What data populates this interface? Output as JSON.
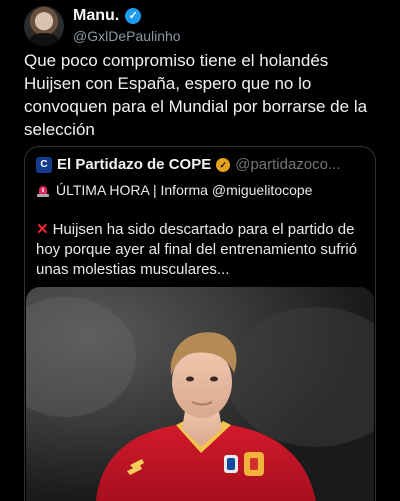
{
  "tweet": {
    "author_name": "Manu.",
    "author_handle": "@GxlDePaulinho",
    "text": "Que poco compromiso tiene el holandés Huijsen con España, espero que no lo convoquen para el Mundial por borrarse de la selección"
  },
  "quoted": {
    "author_name": "El Partidazo de COPE",
    "author_handle": "@partidazoco...",
    "line": "ÚLTIMA HORA | Informa @miguelitocope",
    "body": "Huijsen ha sido descartado para el partido de hoy porque ayer al final del entrenamiento sufrió unas molestias musculares..."
  },
  "colors": {
    "background": "#000000",
    "verified_blue": "#1d9bf0",
    "verified_gold": "#e3a21a",
    "x_red": "#f4212e",
    "shirt_red": "#c8102e"
  },
  "icons": [
    "verified-badge-icon",
    "cope-logo-icon",
    "gold-verified-badge-icon",
    "siren-icon",
    "cross-mark-icon"
  ]
}
